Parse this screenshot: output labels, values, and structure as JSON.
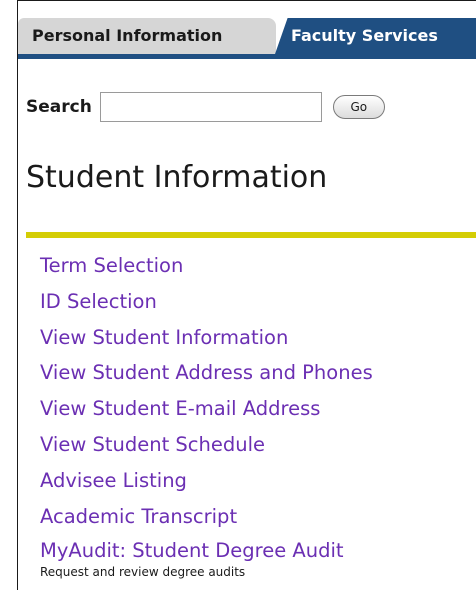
{
  "tabs": [
    {
      "label": "Personal Information"
    },
    {
      "label": "Faculty Services"
    }
  ],
  "search": {
    "label": "Search",
    "value": "",
    "button_label": "Go"
  },
  "page": {
    "title": "Student Information"
  },
  "menu": {
    "items": [
      {
        "label": "Term Selection"
      },
      {
        "label": "ID Selection"
      },
      {
        "label": "View Student Information"
      },
      {
        "label": "View Student Address and Phones"
      },
      {
        "label": "View Student E-mail Address"
      },
      {
        "label": "View Student Schedule"
      },
      {
        "label": "Advisee Listing"
      },
      {
        "label": "Academic Transcript"
      },
      {
        "label": "MyAudit: Student Degree Audit",
        "description": "Request and review degree audits"
      }
    ]
  },
  "colors": {
    "tab_active": "#1f4f82",
    "tab_inactive": "#d6d6d6",
    "accent_rule": "#d4cd05",
    "link": "#6b2fb3"
  }
}
